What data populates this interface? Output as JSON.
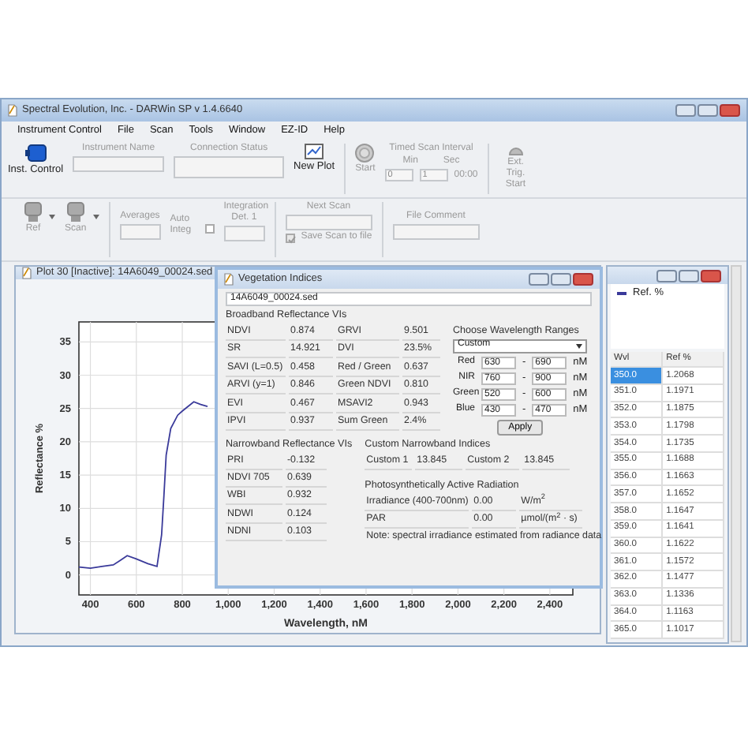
{
  "window": {
    "title": "Spectral Evolution, Inc. - DARWin SP v 1.4.6640"
  },
  "menu": [
    "Instrument Control",
    "File",
    "Scan",
    "Tools",
    "Window",
    "EZ-ID",
    "Help"
  ],
  "toolbar": {
    "inst_control": "Inst. Control",
    "instrument_name_label": "Instrument Name",
    "connection_status_label": "Connection Status",
    "new_plot": "New Plot",
    "start": "Start",
    "timed_scan_label": "Timed Scan Interval",
    "min_label": "Min",
    "sec_label": "Sec",
    "min_value": "0",
    "sec_value": "1",
    "interval_readout": "00:00",
    "ext_trig": "Ext. Trig. Start"
  },
  "toolbar2": {
    "ref": "Ref",
    "scan": "Scan",
    "averages_label": "Averages",
    "auto_integ_label": "Auto Integ",
    "auto_integ_checked": false,
    "integration_label": "Integration Det. 1",
    "next_scan_label": "Next Scan",
    "save_scan": {
      "label": "Save Scan to file",
      "checked": true
    },
    "file_comment_label": "File Comment"
  },
  "plot_window": {
    "title": "Plot 30 [Inactive]: 14A6049_00024.sed",
    "chart_data": {
      "type": "line",
      "grid": true,
      "xlabel": "Wavelength, nM",
      "ylabel": "Reflectance %",
      "xlim": [
        350,
        2500
      ],
      "ylim": [
        -3,
        38
      ],
      "xticks": [
        {
          "value": 400,
          "label": "400"
        },
        {
          "value": 600,
          "label": "600"
        },
        {
          "value": 800,
          "label": "800"
        },
        {
          "value": 1000,
          "label": "1,000"
        },
        {
          "value": 1200,
          "label": "1,200"
        },
        {
          "value": 1400,
          "label": "1,400"
        },
        {
          "value": 1600,
          "label": "1,600"
        },
        {
          "value": 1800,
          "label": "1,800"
        },
        {
          "value": 2000,
          "label": "2,000"
        },
        {
          "value": 2200,
          "label": "2,200"
        },
        {
          "value": 2400,
          "label": "2,400"
        }
      ],
      "yticks": [
        0,
        5,
        10,
        15,
        20,
        25,
        30,
        35
      ],
      "x": [
        350,
        400,
        450,
        500,
        530,
        560,
        600,
        650,
        690,
        710,
        720,
        730,
        750,
        780,
        800,
        850,
        880,
        910
      ],
      "series": [
        {
          "name": "Ref. %",
          "color": "#3a3a9a",
          "values": [
            1.2,
            1.0,
            1.3,
            1.5,
            2.2,
            2.9,
            2.4,
            1.7,
            1.3,
            6,
            12,
            18,
            22,
            24,
            24.6,
            26,
            25.6,
            25.3
          ]
        }
      ]
    }
  },
  "dialog": {
    "title": "Vegetation Indices",
    "file": "14A6049_00024.sed",
    "broadband_title": "Broadband Reflectance VIs",
    "broadband": [
      [
        "NDVI",
        "0.874",
        "GRVI",
        "9.501"
      ],
      [
        "SR",
        "14.921",
        "DVI",
        "23.5%"
      ],
      [
        "SAVI (L=0.5)",
        "0.458",
        "Red / Green",
        "0.637"
      ],
      [
        "ARVI (y=1)",
        "0.846",
        "Green NDVI",
        "0.810"
      ],
      [
        "EVI",
        "0.467",
        "MSAVI2",
        "0.943"
      ],
      [
        "IPVI",
        "0.937",
        "Sum Green",
        "2.4%"
      ]
    ],
    "ranges_title": "Choose Wavelength Ranges",
    "ranges_choice": "Custom",
    "ranges": [
      {
        "name": "Red",
        "from": "630",
        "separator": "-",
        "to": "690",
        "unit": "nM"
      },
      {
        "name": "NIR",
        "from": "760",
        "separator": "-",
        "to": "900",
        "unit": "nM"
      },
      {
        "name": "Green",
        "from": "520",
        "separator": "-",
        "to": "600",
        "unit": "nM"
      },
      {
        "name": "Blue",
        "from": "430",
        "separator": "-",
        "to": "470",
        "unit": "nM"
      }
    ],
    "apply": "Apply",
    "narrowband_title": "Narrowband Reflectance VIs",
    "narrowband": [
      [
        "PRI",
        "-0.132"
      ],
      [
        "NDVI 705",
        "0.639"
      ],
      [
        "WBI",
        "0.932"
      ],
      [
        "NDWI",
        "0.124"
      ],
      [
        "NDNI",
        "0.103"
      ]
    ],
    "custom_title": "Custom Narrowband Indices",
    "custom": [
      [
        "Custom 1",
        "13.845"
      ],
      [
        "Custom 2",
        "13.845"
      ]
    ],
    "par_title": "Photosynthetically Active Radiation",
    "par": [
      [
        "Irradiance (400-700nm)",
        "0.00",
        "W/m$^{2}$"
      ],
      [
        "PAR",
        "0.00",
        "µmol/(m$^{2}$ · s)"
      ]
    ],
    "note": "Note: spectral irradiance estimated from radiance data"
  },
  "data_panel": {
    "columns": [
      "Wvl",
      "Ref %"
    ],
    "rows": [
      {
        "cells": [
          "350.0",
          "1.2068"
        ],
        "selected": true
      },
      {
        "cells": [
          "351.0",
          "1.1971"
        ],
        "selected": false
      },
      {
        "cells": [
          "352.0",
          "1.1875"
        ],
        "selected": false
      },
      {
        "cells": [
          "353.0",
          "1.1798"
        ],
        "selected": false
      },
      {
        "cells": [
          "354.0",
          "1.1735"
        ],
        "selected": false
      },
      {
        "cells": [
          "355.0",
          "1.1688"
        ],
        "selected": false
      },
      {
        "cells": [
          "356.0",
          "1.1663"
        ],
        "selected": false
      },
      {
        "cells": [
          "357.0",
          "1.1652"
        ],
        "selected": false
      },
      {
        "cells": [
          "358.0",
          "1.1647"
        ],
        "selected": false
      },
      {
        "cells": [
          "359.0",
          "1.1641"
        ],
        "selected": false
      },
      {
        "cells": [
          "360.0",
          "1.1622"
        ],
        "selected": false
      },
      {
        "cells": [
          "361.0",
          "1.1572"
        ],
        "selected": false
      },
      {
        "cells": [
          "362.0",
          "1.1477"
        ],
        "selected": false
      },
      {
        "cells": [
          "363.0",
          "1.1336"
        ],
        "selected": false
      },
      {
        "cells": [
          "364.0",
          "1.1163"
        ],
        "selected": false
      },
      {
        "cells": [
          "365.0",
          "1.1017"
        ],
        "selected": false
      }
    ]
  }
}
